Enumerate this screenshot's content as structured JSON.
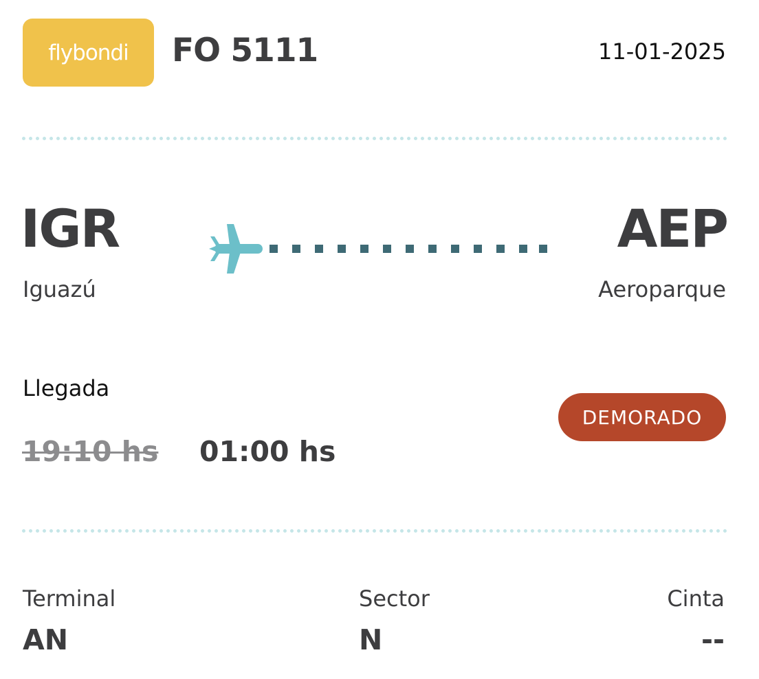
{
  "header": {
    "logo_text": "flybondi",
    "flight_number": "FO 5111",
    "date": "11-01-2025"
  },
  "route": {
    "origin": {
      "code": "IGR",
      "city": "Iguazú"
    },
    "destination": {
      "code": "AEP",
      "city": "Aeroparque"
    },
    "icons": {
      "plane": "airplane-icon"
    }
  },
  "arrival": {
    "label": "Llegada",
    "scheduled_time": "19:10 hs",
    "estimated_time": "01:00 hs",
    "status": "DEMORADO"
  },
  "details": {
    "terminal": {
      "label": "Terminal",
      "value": "AN"
    },
    "sector": {
      "label": "Sector",
      "value": "N"
    },
    "belt": {
      "label": "Cinta",
      "value": "--"
    }
  },
  "colors": {
    "brand_yellow": "#f0c24b",
    "status_delayed": "#b5472a",
    "plane": "#6cbfc9",
    "route_dots": "#3e6a75",
    "divider": "#c5e6e8",
    "text_dark": "#3d3d3f",
    "text_muted": "#8c8c8e"
  }
}
